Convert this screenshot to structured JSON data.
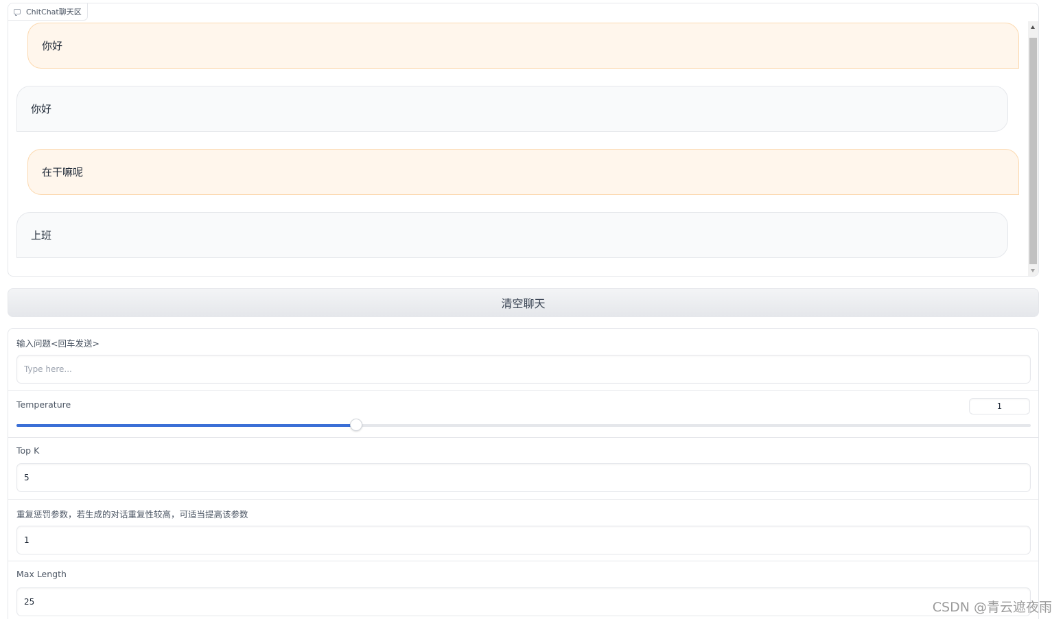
{
  "chatbot": {
    "label": "ChitChat聊天区",
    "messages": [
      {
        "role": "user",
        "text": "你好"
      },
      {
        "role": "bot",
        "text": "你好"
      },
      {
        "role": "user",
        "text": "在干嘛呢"
      },
      {
        "role": "bot",
        "text": "上班"
      }
    ]
  },
  "clear_button": {
    "label": "清空聊天"
  },
  "form": {
    "question": {
      "label": "输入问题<回车发送>",
      "placeholder": "Type here...",
      "value": ""
    },
    "temperature": {
      "label": "Temperature",
      "value": "1",
      "slider_fraction": 0.335
    },
    "top_k": {
      "label": "Top K",
      "value": "5"
    },
    "repetition_penalty": {
      "label": "重复惩罚参数，若生成的对话重复性较高，可适当提高该参数",
      "value": "1"
    },
    "max_length": {
      "label": "Max Length",
      "value": "25"
    }
  },
  "watermark": "CSDN @青云遮夜雨",
  "colors": {
    "user_bubble": "#fff6ec",
    "bot_bubble": "#f9fafb",
    "slider_accent": "#3b6fd6"
  }
}
